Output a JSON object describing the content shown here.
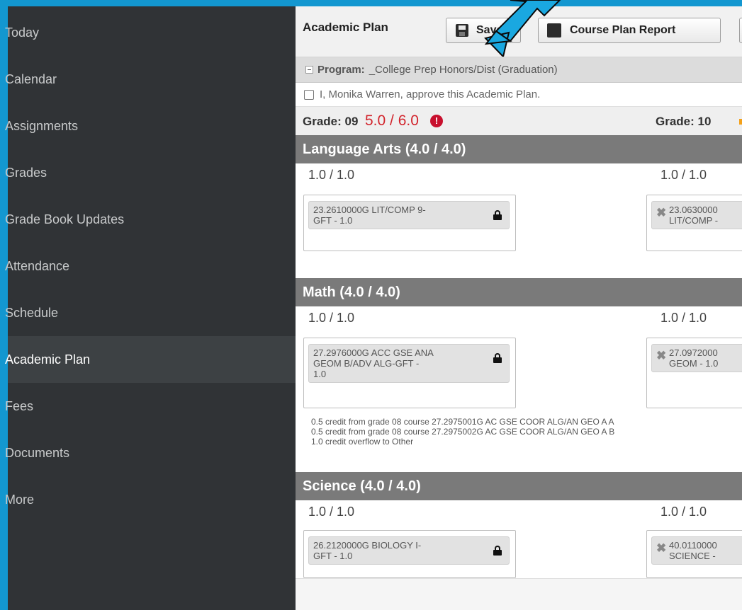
{
  "sidebar": {
    "items": [
      {
        "label": "Today"
      },
      {
        "label": "Calendar"
      },
      {
        "label": "Assignments"
      },
      {
        "label": "Grades"
      },
      {
        "label": "Grade Book Updates"
      },
      {
        "label": "Attendance"
      },
      {
        "label": "Schedule"
      },
      {
        "label": "Academic Plan"
      },
      {
        "label": "Fees"
      },
      {
        "label": "Documents"
      },
      {
        "label": "More"
      }
    ],
    "active": "Academic Plan"
  },
  "toolbar": {
    "title": "Academic Plan",
    "save_label": "Save",
    "report_label": "Course Plan Report"
  },
  "program": {
    "key": "Program:",
    "value": "_College Prep Honors/Dist (Graduation)"
  },
  "approval": {
    "text": "I, Monika Warren, approve this Academic Plan."
  },
  "grades": {
    "g09": {
      "label": "Grade: 09",
      "credits": "5.0 / 6.0",
      "alert": "!"
    },
    "g10": {
      "label": "Grade: 10"
    }
  },
  "sections": {
    "language_arts": {
      "title": "Language Arts (4.0 / 4.0)",
      "credit_left": "1.0 / 1.0",
      "credit_right": "1.0 / 1.0",
      "course_left_line1": "23.2610000G LIT/COMP 9-",
      "course_left_line2": "GFT - 1.0",
      "course_right_line1": "23.0630000",
      "course_right_line2": "LIT/COMP -"
    },
    "math": {
      "title": "Math (4.0 / 4.0)",
      "credit_left": "1.0 / 1.0",
      "credit_right": "1.0 / 1.0",
      "course_left_line1": "27.2976000G ACC GSE ANA",
      "course_left_line2": "GEOM B/ADV ALG-GFT -",
      "course_left_line3": "1.0",
      "course_right_line1": "27.0972000",
      "course_right_line2": "GEOM - 1.0",
      "notes": [
        "0.5 credit from grade 08 course 27.2975001G AC GSE COOR ALG/AN GEO A A",
        "0.5 credit from grade 08 course 27.2975002G AC GSE COOR ALG/AN GEO A B",
        "1.0 credit overflow to Other"
      ]
    },
    "science": {
      "title": "Science (4.0 / 4.0)",
      "credit_left": "1.0 / 1.0",
      "credit_right": "1.0 / 1.0",
      "course_left_line1": "26.2120000G BIOLOGY I-",
      "course_left_line2": "GFT - 1.0",
      "course_right_line1": "40.0110000",
      "course_right_line2": "SCIENCE -"
    }
  },
  "colors": {
    "frame": "#1397d0",
    "sidebar": "#303336",
    "section_header": "#7a7a7a",
    "alert_red": "#d2242c",
    "arrow": "#1aa8e0"
  }
}
